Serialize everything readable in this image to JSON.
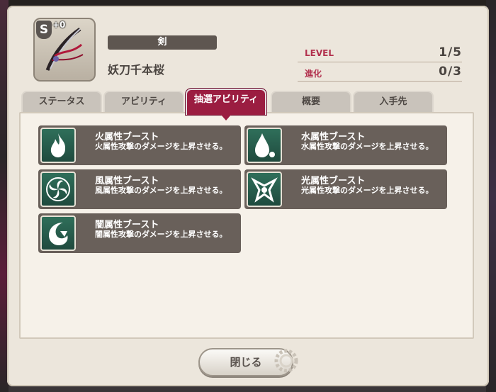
{
  "item": {
    "rank_badge": "S",
    "plus": "+0",
    "category": "剣",
    "name": "妖刀千本桜"
  },
  "stats": [
    {
      "label": "LEVEL",
      "value": "1/5"
    },
    {
      "label": "進化",
      "value": "0/3"
    }
  ],
  "tabs": [
    {
      "label": "ステータス",
      "active": false
    },
    {
      "label": "アビリティ",
      "active": false
    },
    {
      "label": "抽選アビリティ",
      "active": true
    },
    {
      "label": "概要",
      "active": false
    },
    {
      "label": "入手先",
      "active": false
    }
  ],
  "abilities": [
    {
      "title": "火属性ブースト",
      "desc": "火属性攻撃のダメージを上昇させる。",
      "icon": "fire-icon"
    },
    {
      "title": "水属性ブースト",
      "desc": "水属性攻撃のダメージを上昇させる。",
      "icon": "water-drop-icon"
    },
    {
      "title": "風属性ブースト",
      "desc": "風属性攻撃のダメージを上昇させる。",
      "icon": "wind-swirl-icon"
    },
    {
      "title": "光属性ブースト",
      "desc": "光属性攻撃のダメージを上昇させる。",
      "icon": "light-emblem-icon"
    },
    {
      "title": "闇属性ブースト",
      "desc": "闇属性攻撃のダメージを上昇させる。",
      "icon": "dark-moon-icon"
    }
  ],
  "close_label": "閉じる",
  "colors": {
    "accent": "#9b1d41",
    "panel": "#69605a",
    "icon_bg": "#2f6f5a"
  }
}
